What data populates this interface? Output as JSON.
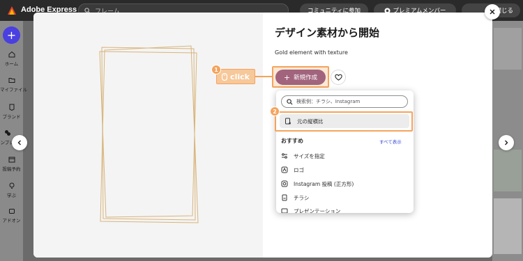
{
  "app": {
    "brand": "Adobe Express",
    "search_placeholder": "フレーム",
    "community_button": "コミュニティに参加",
    "premium_button": "プレミアムメンバー",
    "close_label_partial": "閉じる"
  },
  "sidebar": {
    "items": [
      {
        "label": "ホーム",
        "icon": "home-icon"
      },
      {
        "label": "マイファイル",
        "icon": "folder-icon"
      },
      {
        "label": "ブランド",
        "icon": "brand-icon"
      },
      {
        "label": "テンプレート",
        "icon": "templates-icon"
      },
      {
        "label": "投稿予約",
        "icon": "calendar-icon"
      },
      {
        "label": "学ぶ",
        "icon": "bulb-icon"
      },
      {
        "label": "アドオン",
        "icon": "addon-icon"
      }
    ]
  },
  "modal": {
    "title": "デザイン素材から開始",
    "subtitle": "Gold element with texture",
    "create_button": "新規作成",
    "dropdown": {
      "search_placeholder": "検索例：チラシ、Instagram",
      "aspect_option": "元の縦横比",
      "heading": "おすすめ",
      "see_all": "すべて表示",
      "items": [
        {
          "label": "サイズを指定",
          "icon": "sliders-icon"
        },
        {
          "label": "ロゴ",
          "icon": "logo-icon"
        },
        {
          "label": "Instagram 投稿 (正方形)",
          "icon": "instagram-icon"
        },
        {
          "label": "チラシ",
          "icon": "flyer-icon"
        },
        {
          "label": "プレゼンテーション",
          "icon": "presentation-icon"
        }
      ]
    }
  },
  "callouts": {
    "step1": "1",
    "step1_text": "click",
    "step2": "2"
  },
  "colors": {
    "accent": "#a1647c",
    "highlight": "#f5a35c",
    "link": "#3a4ed6",
    "fab": "#4a3fe0"
  }
}
